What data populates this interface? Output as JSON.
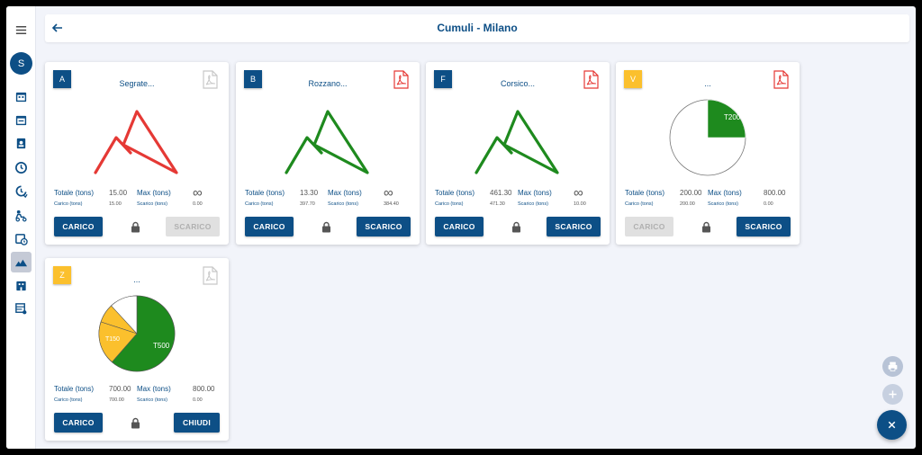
{
  "header": {
    "title": "Cumuli - Milano",
    "back_icon": "arrow-left-icon"
  },
  "sidebar": {
    "avatar": "S",
    "icons": [
      "calendar-icon",
      "calendar-alt-icon",
      "badge-icon",
      "clock-icon",
      "clock-refresh-icon",
      "truck-person-icon",
      "calendar-clock-icon",
      "mountain-icon",
      "building-icon",
      "table-settings-icon"
    ],
    "active": "mountain-icon"
  },
  "colors": {
    "primary": "#0d4f86",
    "red": "#e53935",
    "green": "#1e8a1e",
    "yellow": "#fbc02d"
  },
  "labels": {
    "totale": "Totale (tons)",
    "max": "Max (tons)",
    "carico_sub": "Carico (tons)",
    "scarico_sub": "Scarico (tons)",
    "carico_btn": "CARICO",
    "scarico_btn": "SCARICO",
    "chiudi_btn": "CHIUDI"
  },
  "cards": [
    {
      "badge": "A",
      "name": "Segrate...",
      "totale": "15.00",
      "max": "∞",
      "carico": "15.00",
      "scarico": "0.00",
      "right_btn": "SCARICO"
    },
    {
      "badge": "B",
      "name": "Rozzano...",
      "totale": "13.30",
      "max": "∞",
      "carico": "397.70",
      "scarico": "384.40",
      "right_btn": "SCARICO"
    },
    {
      "badge": "F",
      "name": "Corsico...",
      "totale": "461.30",
      "max": "∞",
      "carico": "471.30",
      "scarico": "10.00",
      "right_btn": "SCARICO"
    },
    {
      "badge": "V",
      "name": "...",
      "totale": "200.00",
      "max": "800.00",
      "carico": "200.00",
      "scarico": "0.00",
      "right_btn": "SCARICO",
      "pie_label": "T200"
    },
    {
      "badge": "Z",
      "name": "...",
      "totale": "700.00",
      "max": "800.00",
      "carico": "700.00",
      "scarico": "0.00",
      "right_btn": "CHIUDI",
      "pie_labels": [
        "T500",
        "T150"
      ]
    }
  ],
  "fabs": [
    "print-icon",
    "plus-icon",
    "close-icon"
  ]
}
